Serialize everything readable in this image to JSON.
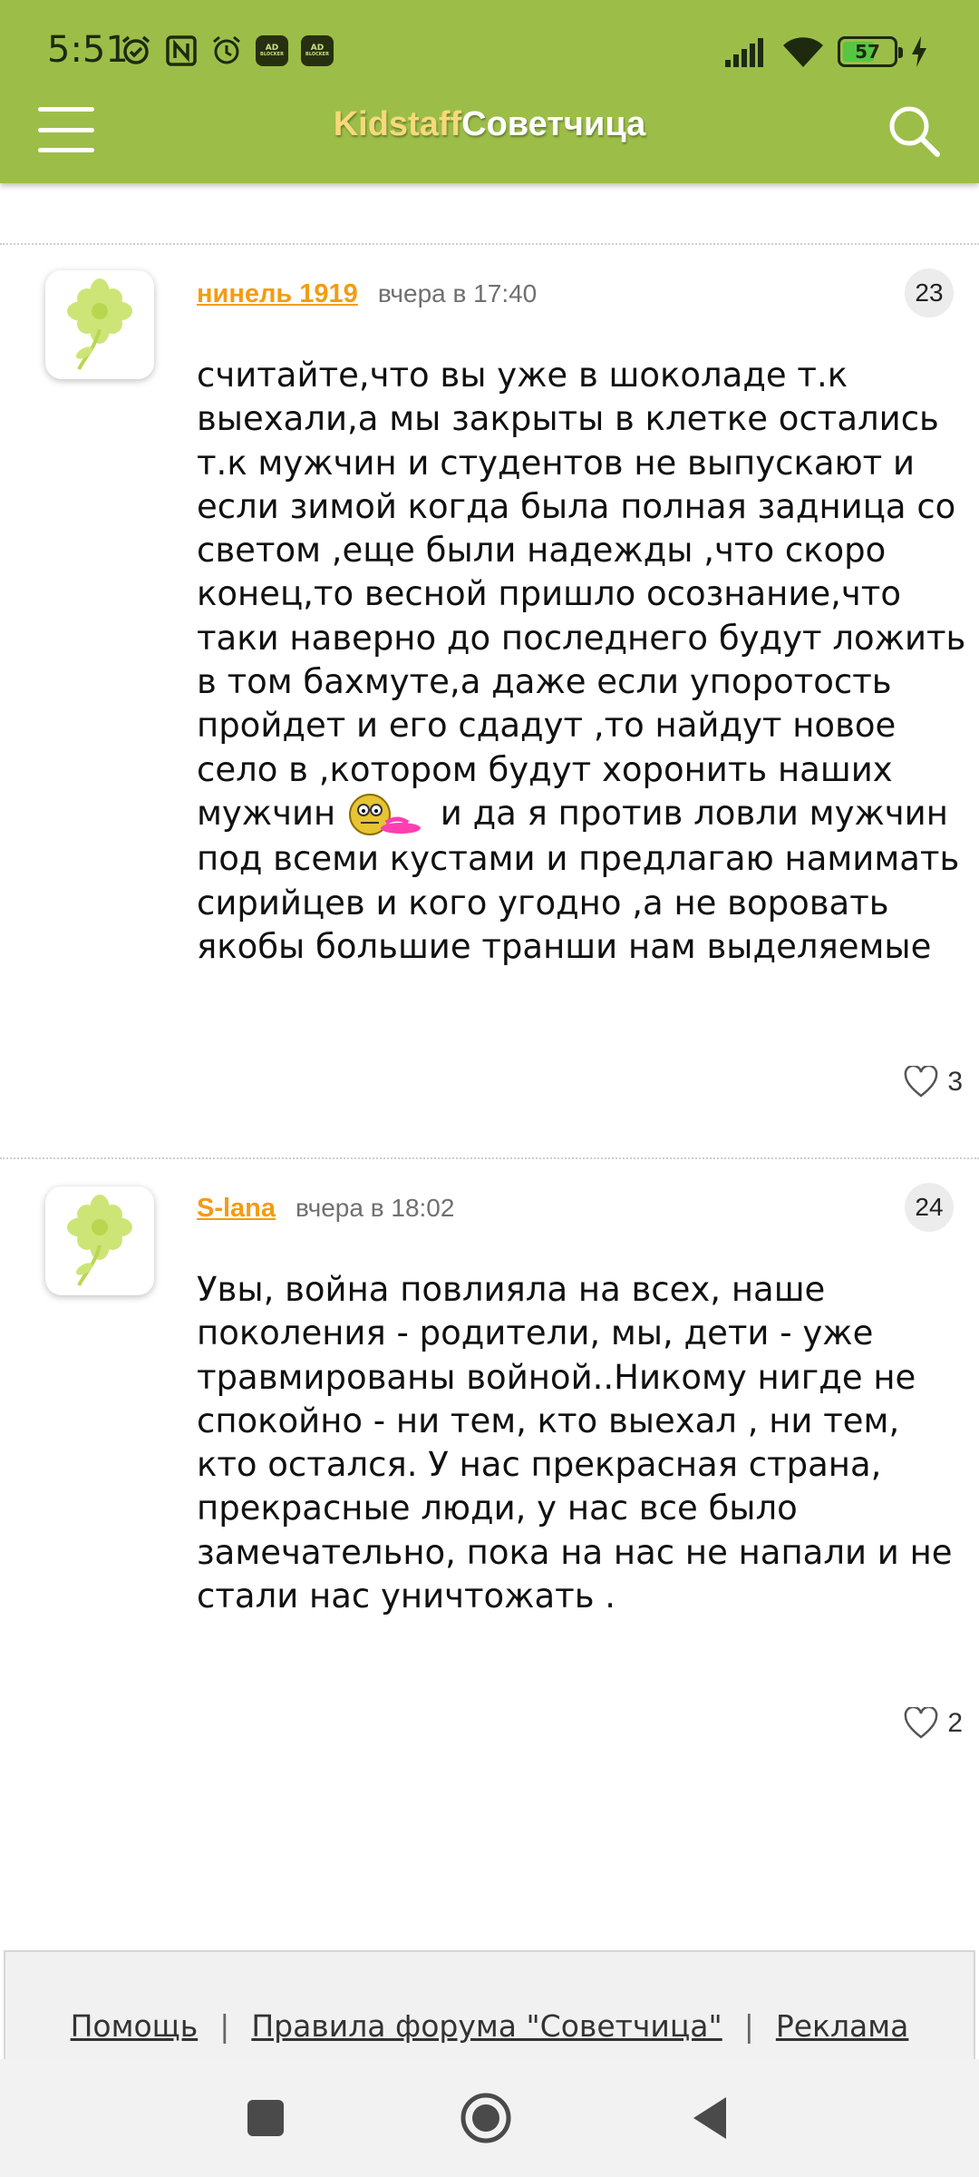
{
  "status_bar": {
    "time": "5:51",
    "battery": "57",
    "battery_level": 0.57,
    "ad_badge": "AD",
    "ad_badge_sub": "BLOCKER",
    "icons": [
      "alarm-check-icon",
      "nfc-icon",
      "alarm-icon",
      "ad-blocker-icon",
      "ad-blocker-icon",
      "signal-icon",
      "wifi-icon",
      "battery-icon",
      "charging-icon"
    ]
  },
  "header": {
    "logo_part1": "Kidstaff",
    "logo_part2": "Советчица",
    "colors": {
      "background": "#9cbe48",
      "logo_part1": "#f6d979",
      "logo_part2": "#ffffff"
    }
  },
  "posts": [
    {
      "author": "нинель 1919",
      "date": "вчера в 17:40",
      "number": "23",
      "text_before_emoji": "считайте,что вы уже в шоколаде т.к выехали,а мы закрыты в клетке остались т.к мужчин и студентов не выпускают и если зимой когда была полная задница со светом ,еще были надежды ,что скоро конец,то весной пришло осознание,что таки наверно до последнего будут ложить в том бахмуте,а даже если упоротость пройдет и его сдадут ,то найдут новое село в ,котором будут хоронить наших мужчин",
      "text_after_emoji": "и да я против ловли мужчин под всеми кустами и предлагаю намимать сирийцев и кого угодно ,а не воровать якобы большие транши нам выделяемые",
      "likes": "3"
    },
    {
      "author": "S-lana",
      "date": "вчера в 18:02",
      "number": "24",
      "text": "Увы, война повлияла на всех, наше поколения - родители, мы, дети - уже травмированы войной..Никому нигде не спокойно - ни тем, кто выехал , ни тем, кто остался. У нас прекрасная страна, прекрасные люди, у нас все было замечательно, пока на нас не напали и не стали нас уничтожать .",
      "likes": "2"
    }
  ],
  "footer": {
    "links": [
      "Помощь",
      "Правила форума \"Советчица\"",
      "Реклама"
    ],
    "separator": "|"
  },
  "nav": {
    "icons": [
      "recents-square-icon",
      "home-circle-icon",
      "back-triangle-icon"
    ]
  },
  "colors": {
    "author": "#f39c12",
    "accent": "#9cbe48"
  }
}
